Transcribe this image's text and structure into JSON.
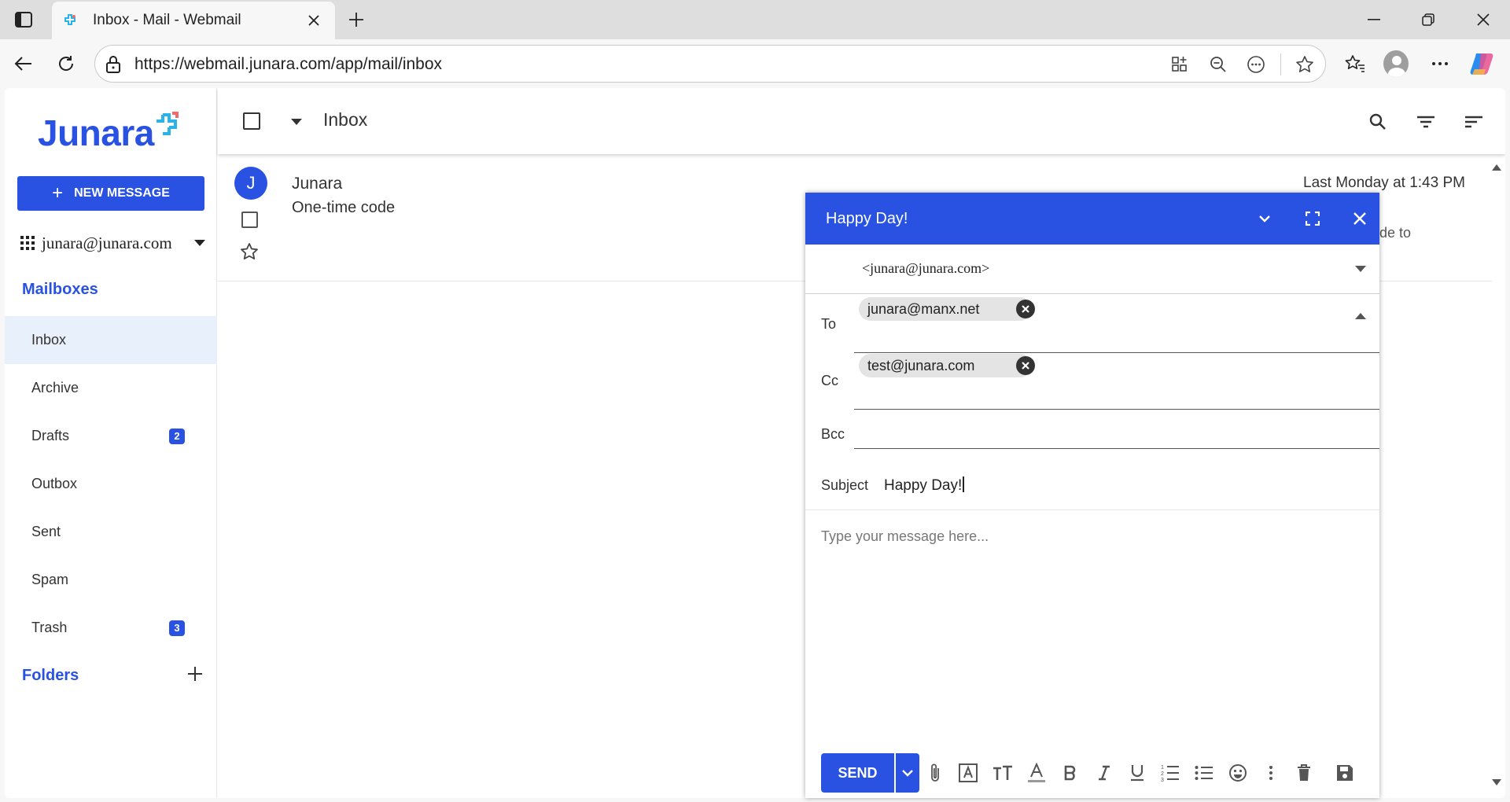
{
  "browser": {
    "tab_title": "Inbox - Mail - Webmail",
    "url": "https://webmail.junara.com/app/mail/inbox"
  },
  "colors": {
    "brand": "#2952e3",
    "active_item_bg": "#e8f0fb"
  },
  "sidebar": {
    "logo_text": "Junara",
    "new_message_label": "NEW MESSAGE",
    "account_email": "junara@junara.com",
    "mailboxes_title": "Mailboxes",
    "mailboxes": [
      {
        "label": "Inbox",
        "badge": ""
      },
      {
        "label": "Archive",
        "badge": ""
      },
      {
        "label": "Drafts",
        "badge": "2"
      },
      {
        "label": "Outbox",
        "badge": ""
      },
      {
        "label": "Sent",
        "badge": ""
      },
      {
        "label": "Spam",
        "badge": ""
      },
      {
        "label": "Trash",
        "badge": "3"
      }
    ],
    "folders_title": "Folders"
  },
  "main": {
    "title": "Inbox",
    "message": {
      "avatar_letter": "J",
      "sender": "Junara",
      "subject": "One-time code",
      "time": "Last Monday at 1:43 PM",
      "snippet_fragment": "de to"
    }
  },
  "compose": {
    "title": "Happy Day!",
    "from": "<junara@junara.com>",
    "to_label": "To",
    "to_chips": [
      "junara@manx.net"
    ],
    "cc_label": "Cc",
    "cc_chips": [
      "test@junara.com"
    ],
    "bcc_label": "Bcc",
    "subject_label": "Subject",
    "subject_value": "Happy Day!",
    "body_placeholder": "Type your message here...",
    "send_label": "SEND"
  }
}
